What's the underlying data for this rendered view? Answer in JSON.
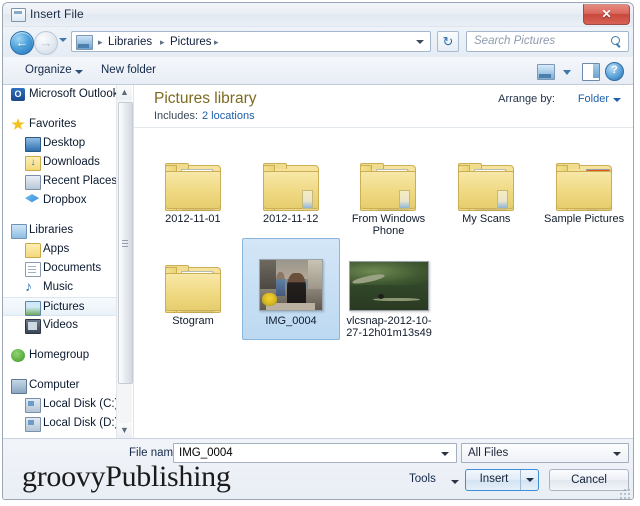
{
  "window": {
    "title": "Insert File",
    "icon": "document-window-icon",
    "close_label": "✕"
  },
  "navbar": {
    "back_glyph": "←",
    "forward_glyph": "→",
    "breadcrumbs": [
      "Libraries",
      "Pictures"
    ],
    "separator": "▸",
    "refresh_glyph": "↻",
    "search_placeholder": "Search Pictures"
  },
  "toolbar": {
    "organize_label": "Organize",
    "new_folder_label": "New folder",
    "help_glyph": "?"
  },
  "sidebar": {
    "items": [
      {
        "label": "Microsoft Outlook",
        "icon": "outlook-icon",
        "level": 0,
        "selected": false,
        "spacer_after": true
      },
      {
        "label": "Favorites",
        "icon": "star-icon",
        "level": 0,
        "selected": false
      },
      {
        "label": "Desktop",
        "icon": "desktop-icon",
        "level": 1,
        "selected": false
      },
      {
        "label": "Downloads",
        "icon": "downloads-folder-icon",
        "level": 1,
        "selected": false
      },
      {
        "label": "Recent Places",
        "icon": "recent-places-icon",
        "level": 1,
        "selected": false
      },
      {
        "label": "Dropbox",
        "icon": "dropbox-icon",
        "level": 1,
        "selected": false,
        "spacer_after": true
      },
      {
        "label": "Libraries",
        "icon": "libraries-icon",
        "level": 0,
        "selected": false
      },
      {
        "label": "Apps",
        "icon": "folder-icon",
        "level": 1,
        "selected": false
      },
      {
        "label": "Documents",
        "icon": "documents-icon",
        "level": 1,
        "selected": false
      },
      {
        "label": "Music",
        "icon": "music-icon",
        "level": 1,
        "selected": false
      },
      {
        "label": "Pictures",
        "icon": "pictures-icon",
        "level": 1,
        "selected": true
      },
      {
        "label": "Videos",
        "icon": "videos-icon",
        "level": 1,
        "selected": false,
        "spacer_after": true
      },
      {
        "label": "Homegroup",
        "icon": "homegroup-icon",
        "level": 0,
        "selected": false,
        "spacer_after": true
      },
      {
        "label": "Computer",
        "icon": "computer-icon",
        "level": 0,
        "selected": false
      },
      {
        "label": "Local Disk (C:)",
        "icon": "disk-icon",
        "level": 1,
        "selected": false
      },
      {
        "label": "Local Disk (D:)",
        "icon": "disk-icon",
        "level": 1,
        "selected": false
      }
    ],
    "scroll_up_glyph": "▲",
    "scroll_down_glyph": "▼"
  },
  "content": {
    "library_title": "Pictures library",
    "includes_label": "Includes:",
    "includes_link": "2 locations",
    "arrange_by_label": "Arrange by:",
    "arrange_by_value": "Folder",
    "items": [
      {
        "name": "2012-11-01",
        "type": "folder",
        "variant": "documents",
        "selected": false
      },
      {
        "name": "2012-11-12",
        "type": "folder",
        "variant": "plain",
        "selected": false
      },
      {
        "name": "From Windows Phone",
        "type": "folder",
        "variant": "stack",
        "selected": false
      },
      {
        "name": "My Scans",
        "type": "folder",
        "variant": "stack",
        "selected": false
      },
      {
        "name": "Sample Pictures",
        "type": "folder",
        "variant": "photos",
        "selected": false
      },
      {
        "name": "Stogram",
        "type": "folder",
        "variant": "documents",
        "selected": false
      },
      {
        "name": "IMG_0004",
        "type": "image",
        "variant": "street-photo",
        "selected": true
      },
      {
        "name": "vlcsnap-2012-10-27-12h01m13s49",
        "type": "image",
        "variant": "park-photo",
        "selected": false
      }
    ]
  },
  "footer": {
    "filename_label": "File name:",
    "filename_value": "IMG_0004",
    "filetype_value": "All Files",
    "tools_label": "Tools",
    "insert_label": "Insert",
    "cancel_label": "Cancel"
  },
  "watermark": {
    "text": "groovyPublishing"
  },
  "colors": {
    "accent_blue": "#1c5fa8",
    "library_title": "#7d6a20",
    "selection_fill": "#bcd9f1",
    "selection_border": "#8ab6dd",
    "close_red": "#c8483c"
  }
}
